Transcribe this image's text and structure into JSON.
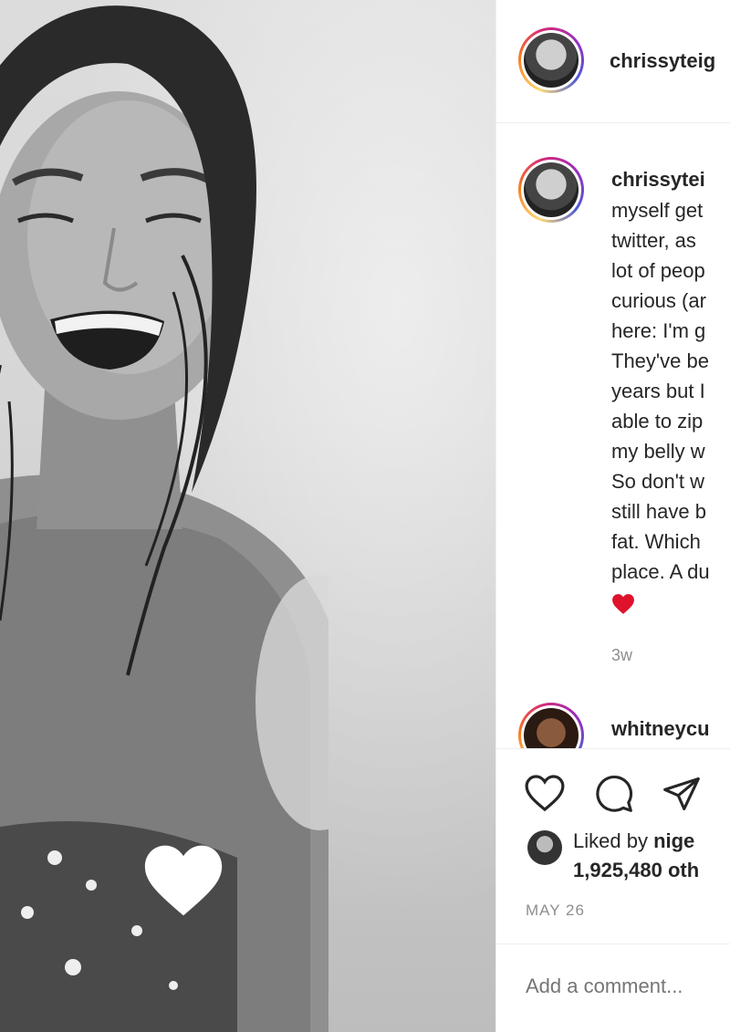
{
  "post": {
    "username": "chrissyteig",
    "like_overlay_icon": "heart-filled-white"
  },
  "caption": {
    "username": "chrissytei",
    "lines": [
      "myself get",
      "twitter, as",
      "lot of peop",
      "curious (ar",
      "here: I'm g",
      "They've be",
      "years but I",
      "able to zip",
      "my belly w",
      "So don't w",
      "still have b",
      "fat. Which",
      "place. A du"
    ],
    "emoji": "red-heart",
    "time": "3w"
  },
  "comment": {
    "username": "whitneycu"
  },
  "actions": {
    "like_icon": "heart-outline",
    "comment_icon": "speech-bubble",
    "share_icon": "paper-plane"
  },
  "likes": {
    "prefix": "Liked by ",
    "user": "nige",
    "count_line": "1,925,480 oth"
  },
  "date": "MAY 26",
  "add_comment": {
    "placeholder": "Add a comment..."
  },
  "colors": {
    "text": "#262626",
    "muted": "#8e8e8e",
    "divider": "#efefef",
    "heart_red": "#ed4956"
  }
}
